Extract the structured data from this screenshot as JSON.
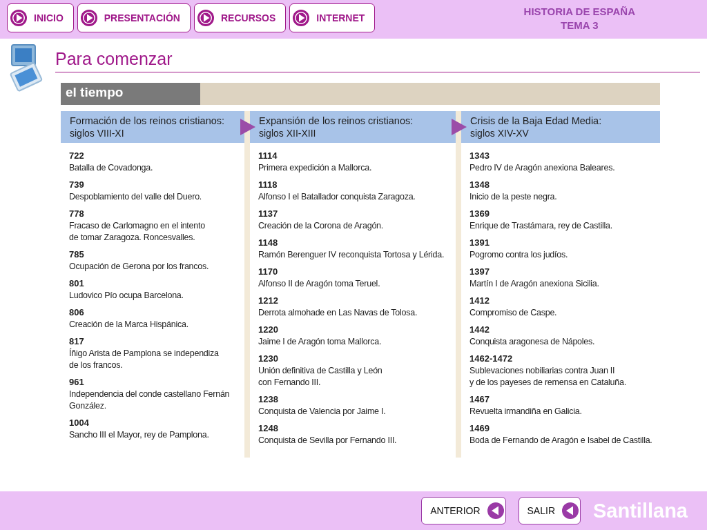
{
  "nav_buttons": [
    {
      "label": "INICIO"
    },
    {
      "label": "PRESENTACIÓN"
    },
    {
      "label": "RECURSOS"
    },
    {
      "label": "INTERNET"
    }
  ],
  "course": {
    "line_1": "HISTORIA DE ESPAÑA",
    "line_2": "TEMA 3"
  },
  "page_title": "Para comenzar",
  "panel": {
    "title": "el tiempo",
    "columns": [
      {
        "heading": "Formación de los reinos cristianos:",
        "subheading": "siglos VIII-XI",
        "events": [
          {
            "year": "722",
            "text": "Batalla de Covadonga."
          },
          {
            "year": "739",
            "text": "Despoblamiento del valle del Duero."
          },
          {
            "year": "778",
            "text": "Fracaso de Carlomagno en el intento\nde tomar Zaragoza. Roncesvalles."
          },
          {
            "year": "785",
            "text": "Ocupación de Gerona por los francos."
          },
          {
            "year": "801",
            "text": "Ludovico Pío ocupa Barcelona."
          },
          {
            "year": "806",
            "text": "Creación de la Marca Hispánica."
          },
          {
            "year": "817",
            "text": "Íñigo Arista de Pamplona se independiza\nde los francos."
          },
          {
            "year": "961",
            "text": "Independencia del conde castellano Fernán\nGonzález."
          },
          {
            "year": "1004",
            "text": "Sancho III el Mayor, rey de Pamplona."
          }
        ]
      },
      {
        "heading": "Expansión de los reinos cristianos:",
        "subheading": "siglos XII-XIII",
        "events": [
          {
            "year": "1114",
            "text": "Primera expedición a Mallorca."
          },
          {
            "year": "1118",
            "text": "Alfonso I el Batallador conquista Zaragoza."
          },
          {
            "year": "1137",
            "text": "Creación de la Corona de Aragón."
          },
          {
            "year": "1148",
            "text": "Ramón Berenguer IV reconquista Tortosa y Lérida."
          },
          {
            "year": "1170",
            "text": "Alfonso II de Aragón toma Teruel."
          },
          {
            "year": "1212",
            "text": "Derrota almohade en Las Navas de Tolosa."
          },
          {
            "year": "1220",
            "text": "Jaime I de Aragón toma Mallorca."
          },
          {
            "year": "1230",
            "text": "Unión definitiva de Castilla y León\ncon Fernando III."
          },
          {
            "year": "1238",
            "text": "Conquista de Valencia por Jaime I."
          },
          {
            "year": "1248",
            "text": "Conquista de Sevilla por Fernando III."
          }
        ]
      },
      {
        "heading": "Crisis de la Baja Edad Media:",
        "subheading": "siglos XIV-XV",
        "events": [
          {
            "year": "1343",
            "text": "Pedro IV de Aragón anexiona Baleares."
          },
          {
            "year": "1348",
            "text": "Inicio de la peste negra."
          },
          {
            "year": "1369",
            "text": "Enrique de Trastámara, rey de Castilla."
          },
          {
            "year": "1391",
            "text": "Pogromo contra los judíos."
          },
          {
            "year": "1397",
            "text": "Martín I de Aragón anexiona Sicilia."
          },
          {
            "year": "1412",
            "text": "Compromiso de Caspe."
          },
          {
            "year": "1442",
            "text": "Conquista aragonesa de Nápoles."
          },
          {
            "year": "1462-1472",
            "text": "Sublevaciones nobiliarias contra Juan II\ny de los payeses de remensa en Cataluña."
          },
          {
            "year": "1467",
            "text": "Revuelta irmandiña en Galicia."
          },
          {
            "year": "1469",
            "text": "Boda de Fernando de Aragón e Isabel de Castilla."
          }
        ]
      }
    ]
  },
  "footer_buttons": [
    {
      "label": "ANTERIOR"
    },
    {
      "label": "SALIR"
    }
  ],
  "brand": "Santillana"
}
